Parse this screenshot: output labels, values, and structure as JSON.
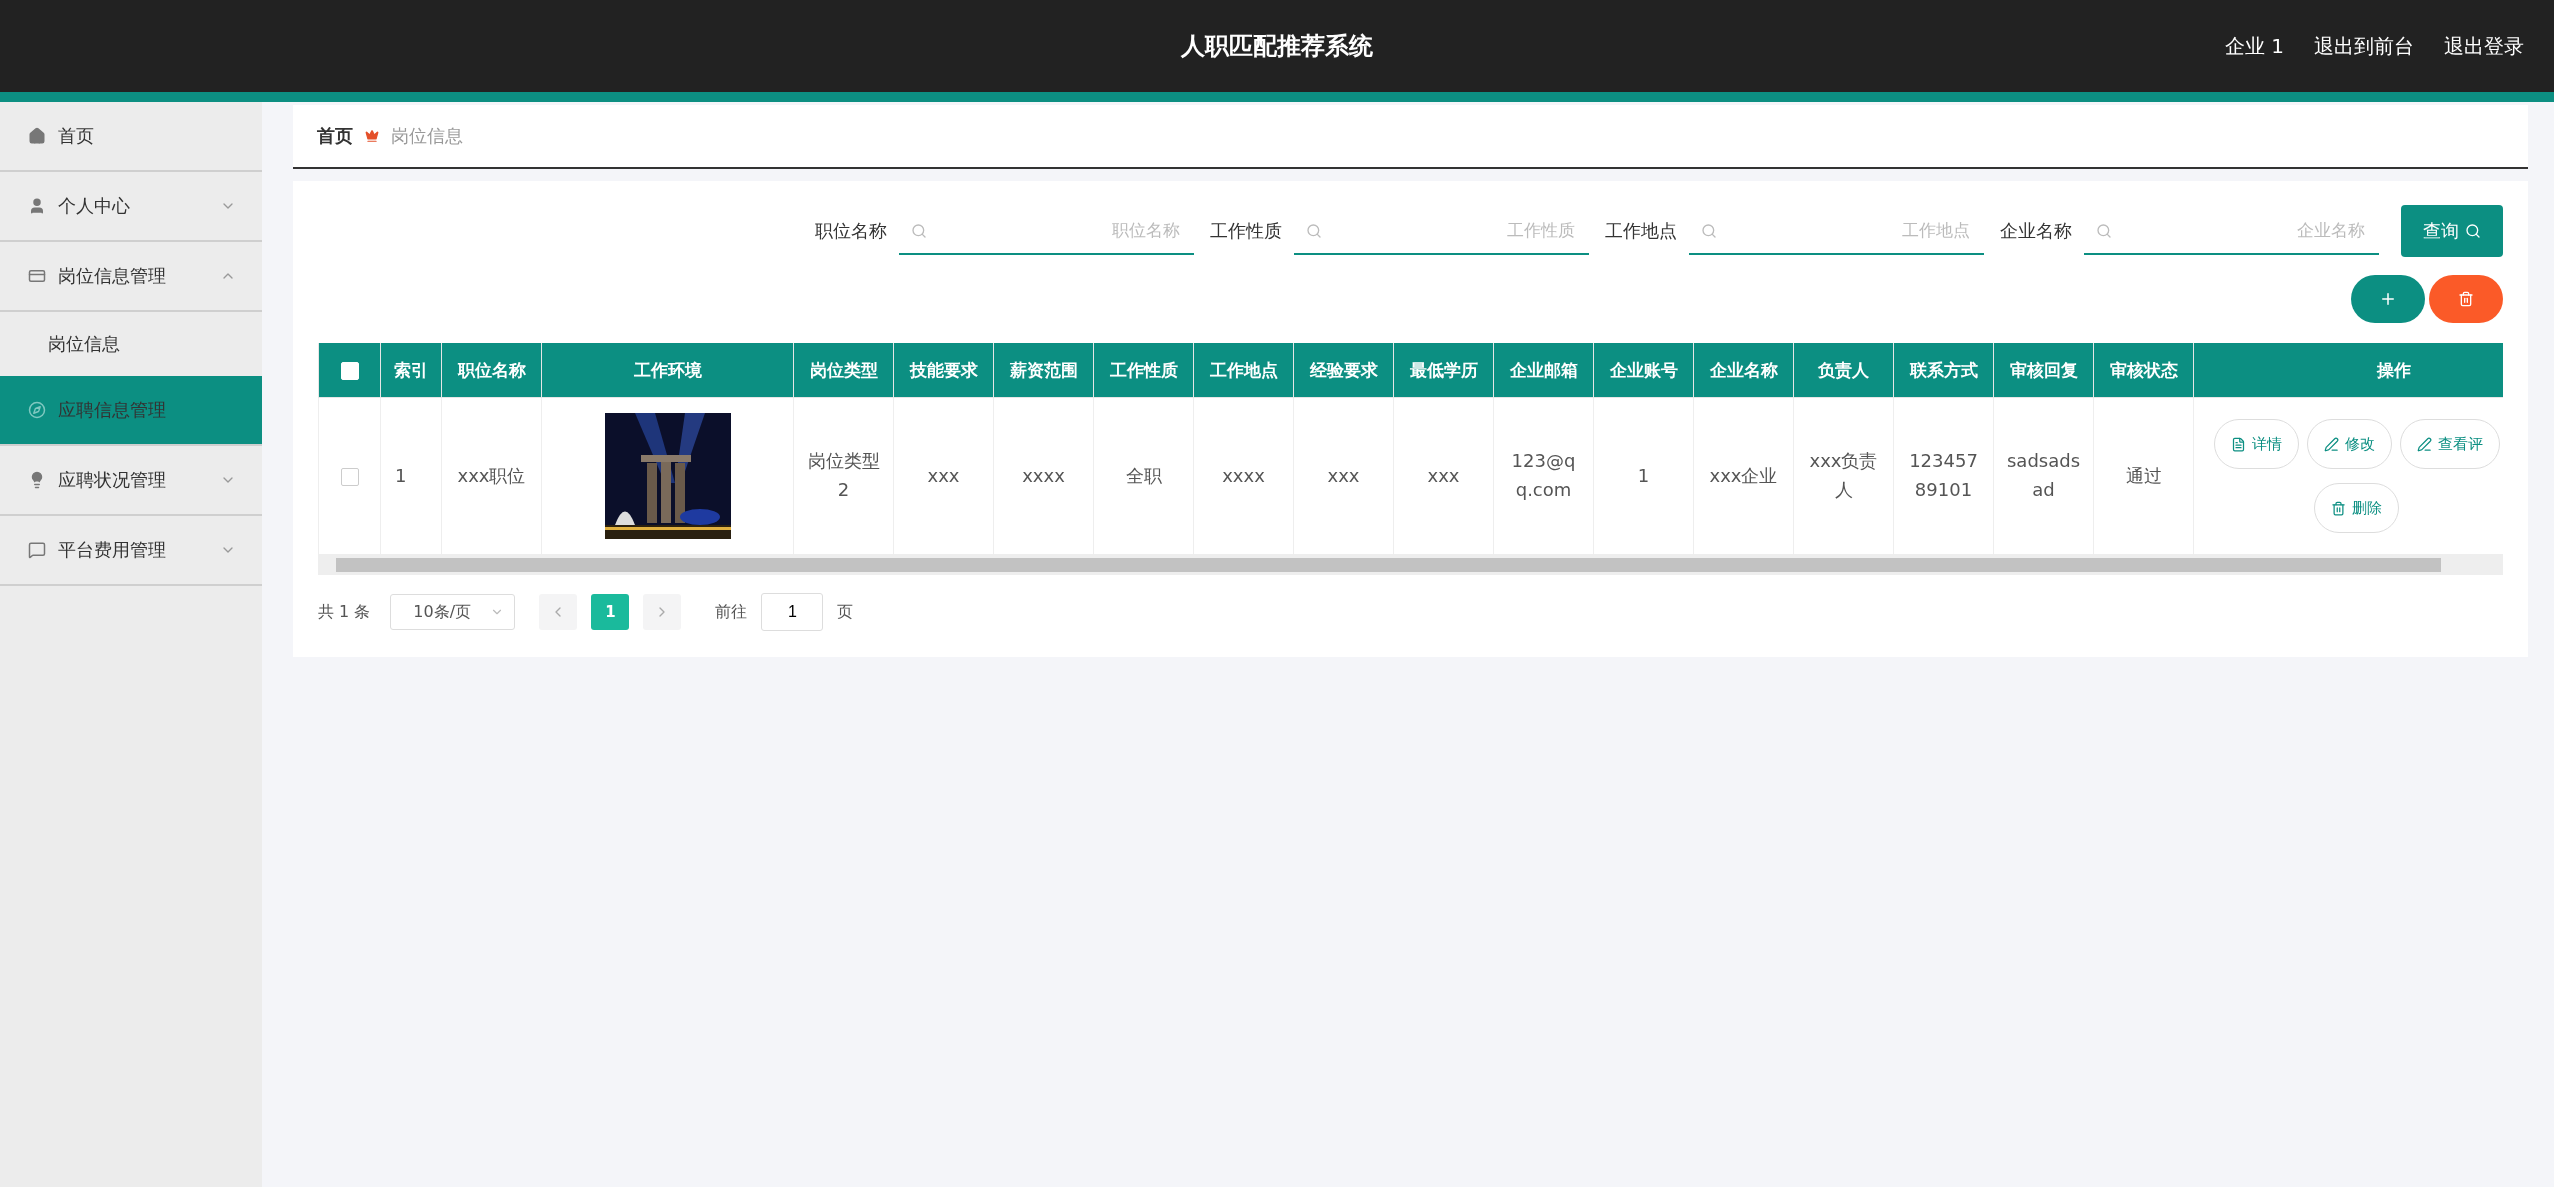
{
  "header": {
    "title": "人职匹配推荐系统",
    "links": [
      "企业 1",
      "退出到前台",
      "退出登录"
    ]
  },
  "sidebar": {
    "items": [
      {
        "label": "首页",
        "selected": false
      },
      {
        "label": "个人中心",
        "expanded": false,
        "selected": false
      },
      {
        "label": "岗位信息管理",
        "expanded": true,
        "selected": false,
        "children": [
          {
            "label": "岗位信息",
            "selected": false
          }
        ]
      },
      {
        "label": "应聘信息管理",
        "selected": true
      },
      {
        "label": "应聘状况管理",
        "expanded": false,
        "selected": false
      },
      {
        "label": "平台费用管理",
        "expanded": false,
        "selected": false
      }
    ]
  },
  "breadcrumb": [
    "首页",
    "岗位信息"
  ],
  "search": {
    "fields": [
      {
        "label": "职位名称",
        "placeholder": "职位名称"
      },
      {
        "label": "工作性质",
        "placeholder": "工作性质"
      },
      {
        "label": "工作地点",
        "placeholder": "工作地点"
      },
      {
        "label": "企业名称",
        "placeholder": "企业名称"
      }
    ],
    "button": "查询"
  },
  "table": {
    "all_checked": false,
    "columns": [
      "索引",
      "职位名称",
      "工作环境",
      "岗位类型",
      "技能要求",
      "薪资范围",
      "工作性质",
      "工作地点",
      "经验要求",
      "最低学历",
      "企业邮箱",
      "企业账号",
      "企业名称",
      "负责人",
      "联系方式",
      "审核回复",
      "审核状态",
      "操作"
    ],
    "rows": [
      {
        "checked": false,
        "cells": [
          {
            "kind": "index",
            "text": "1"
          },
          {
            "kind": "text",
            "text": "xxx职位"
          },
          {
            "kind": "picture"
          },
          {
            "kind": "text",
            "text": "岗位类型2"
          },
          {
            "kind": "text",
            "text": "xxx"
          },
          {
            "kind": "text",
            "text": "xxxx"
          },
          {
            "kind": "text",
            "text": "全职"
          },
          {
            "kind": "text",
            "text": "xxxx"
          },
          {
            "kind": "text",
            "text": "xxx"
          },
          {
            "kind": "text",
            "text": "xxx"
          },
          {
            "kind": "text",
            "text": "123@qq.com"
          },
          {
            "kind": "text",
            "text": "1"
          },
          {
            "kind": "text",
            "text": "xxx企业"
          },
          {
            "kind": "text",
            "text": "xxx负责人"
          },
          {
            "kind": "text",
            "text": "12345789101"
          },
          {
            "kind": "text",
            "text": "sadsadsad"
          },
          {
            "kind": "text",
            "text": "通过"
          },
          {
            "kind": "actions",
            "actions": [
              "详情",
              "修改",
              "查看评",
              "删除"
            ]
          }
        ]
      }
    ]
  },
  "pagination": {
    "total": "共 1 条",
    "page_size": "10条/页",
    "pages": [
      {
        "label": "1",
        "selected": true
      }
    ],
    "goto_label": "前往",
    "goto_value": "1",
    "page_unit": "页"
  }
}
